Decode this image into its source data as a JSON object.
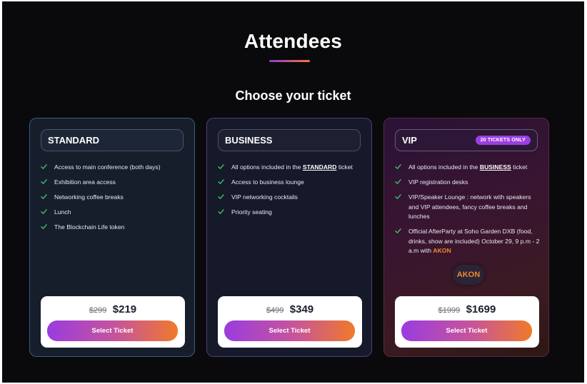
{
  "page": {
    "title": "Attendees",
    "subtitle": "Choose your ticket",
    "accent_gradient": [
      "#8b3dd6",
      "#f2782a"
    ]
  },
  "tickets": [
    {
      "name": "STANDARD",
      "features": [
        "Access to main conference (both days)",
        "Exhibition area access",
        "Networking coffee breaks",
        "Lunch",
        "The Blockchain Life token"
      ],
      "old_price": "$299",
      "price": "$219",
      "button_label": "Select Ticket"
    },
    {
      "name": "BUSINESS",
      "features": [
        {
          "before": "All options included in the ",
          "link": "STANDARD",
          "after": " ticket"
        },
        "Access to business lounge",
        "VIP networking cocktails",
        "Priority seating"
      ],
      "old_price": "$499",
      "price": "$349",
      "button_label": "Select Ticket"
    },
    {
      "name": "VIP",
      "badge": "20 TICKETS ONLY",
      "features": [
        {
          "before": "All options included in the ",
          "link": "BUSINESS",
          "after": " ticket"
        },
        "VIP registration desks",
        "VIP/Speaker Lounge : network with speakers and VIP attendees, fancy coffee breaks and lunches",
        {
          "before": "Official AfterParty at Soho Garden DXB (food, drinks, show are included) October 29, 9 p.m - 2 a.m with ",
          "highlight": "AKON"
        }
      ],
      "artist_chip": "AKON",
      "old_price": "$1999",
      "price": "$1699",
      "button_label": "Select Ticket"
    }
  ],
  "icons": {
    "feature_bullet": "check-icon",
    "check_color": "#3ecf6e"
  }
}
